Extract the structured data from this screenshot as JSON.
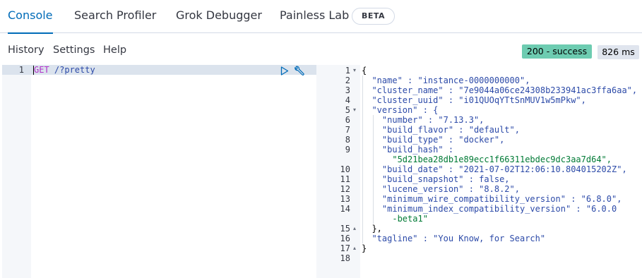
{
  "tabs": [
    {
      "label": "Console",
      "active": true
    },
    {
      "label": "Search Profiler",
      "active": false
    },
    {
      "label": "Grok Debugger",
      "active": false
    },
    {
      "label": "Painless Lab",
      "active": false
    }
  ],
  "beta_badge": "BETA",
  "menu": [
    "History",
    "Settings",
    "Help"
  ],
  "status": {
    "text": "200 - success",
    "color": "#6dccb1"
  },
  "timing": "826 ms",
  "request": {
    "line_number": "1",
    "method": "GET",
    "path": " /?pretty"
  },
  "response": {
    "line_numbers": [
      "1",
      "2",
      "3",
      "4",
      "5",
      "6",
      "7",
      "8",
      "9",
      "",
      "10",
      "11",
      "12",
      "13",
      "14",
      "",
      "15",
      "16",
      "17",
      "18"
    ],
    "fold_markers": {
      "1": "▾",
      "5": "▾",
      "15": "▴",
      "17": "▴"
    },
    "lines": [
      "{",
      "  \"name\" : \"instance-0000000000\",",
      "  \"cluster_name\" : \"7e9044a06ce24308b233941ac3ffa6aa\",",
      "  \"cluster_uuid\" : \"i01QUOqYTtSnMUV1w5mPkw\",",
      "  \"version\" : {",
      "    \"number\" : \"7.13.3\",",
      "    \"build_flavor\" : \"default\",",
      "    \"build_type\" : \"docker\",",
      "    \"build_hash\" :",
      "      \"5d21bea28db1e89ecc1f66311ebdec9dc3aa7d64\",",
      "    \"build_date\" : \"2021-07-02T12:06:10.804015202Z\",",
      "    \"build_snapshot\" : false,",
      "    \"lucene_version\" : \"8.8.2\",",
      "    \"minimum_wire_compatibility_version\" : \"6.8.0\",",
      "    \"minimum_index_compatibility_version\" : \"6.0.0",
      "      -beta1\"",
      "  },",
      "  \"tagline\" : \"You Know, for Search\"",
      "}",
      ""
    ]
  }
}
